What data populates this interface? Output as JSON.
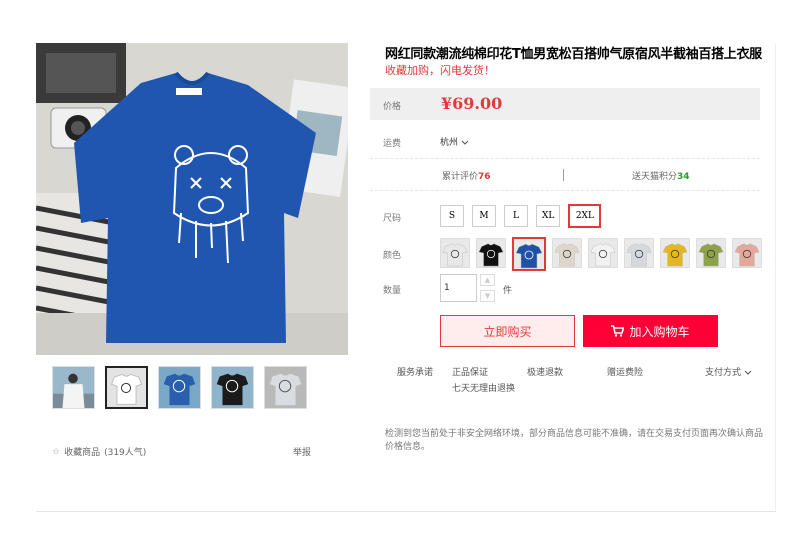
{
  "product": {
    "title": "网红同款潮流纯棉印花T恤男宽松百搭帅气原宿风半截袖百搭上衣服",
    "promo": "收藏加购，闪电发货！"
  },
  "price": {
    "label": "价格",
    "value": "¥69.00"
  },
  "shipping": {
    "label": "运费",
    "from": "杭州"
  },
  "stats": {
    "reviews_label": "累计评价",
    "reviews_count": "76",
    "points_label": "送天猫积分",
    "points_value": "34"
  },
  "sizes": {
    "label": "尺码",
    "options": [
      "S",
      "M",
      "L",
      "XL",
      "2XL"
    ],
    "selected": "2XL"
  },
  "colors": {
    "label": "颜色",
    "swatches": [
      {
        "shirt": "#e8e8e8"
      },
      {
        "shirt": "#111111"
      },
      {
        "shirt": "#1f52a6"
      },
      {
        "shirt": "#ded6cb"
      },
      {
        "shirt": "#f2f2f2"
      },
      {
        "shirt": "#d5d9de"
      },
      {
        "shirt": "#e3b81f"
      },
      {
        "shirt": "#8da24a"
      },
      {
        "shirt": "#e4a89a"
      }
    ],
    "selected_index": 2
  },
  "quantity": {
    "label": "数量",
    "value": "1",
    "unit": "件"
  },
  "buttons": {
    "buy_now": "立即购买",
    "add_to_cart": "加入购物车"
  },
  "services": {
    "label": "服务承诺",
    "items": [
      "正品保证",
      "极速退款",
      "赠运费险",
      "七天无理由退换"
    ],
    "payment": "支付方式"
  },
  "notice": "检测到您当前处于非安全网络环境，部分商品信息可能不准确，请在交易支付页面再次确认商品价格信息。",
  "gallery": {
    "collect_label": "收藏商品",
    "collect_count": "(319人气)",
    "report_label": "举报",
    "thumb_count": 5,
    "active_thumb": 1
  },
  "colors_theme": {
    "accent": "#e4393c",
    "cart": "#ff0036",
    "shirt_main": "#2156b0"
  }
}
